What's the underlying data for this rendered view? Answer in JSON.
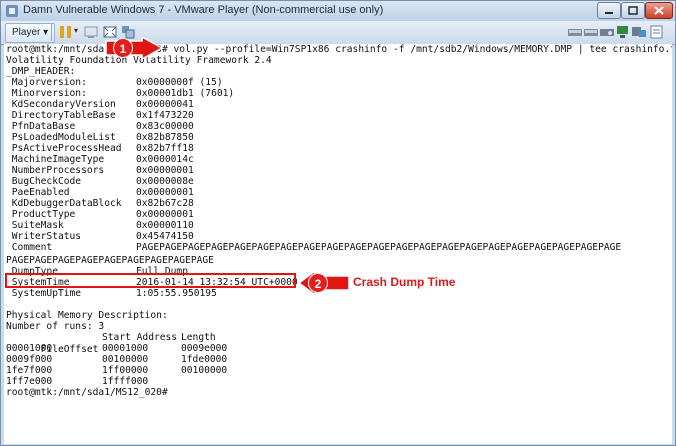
{
  "window": {
    "title": "Damn Vulnerable Windows 7 - VMware Player (Non-commercial use only)",
    "player_menu": "Player"
  },
  "terminal": {
    "prompt_line": "root@mtk:/mnt/sda1/MS12_020# vol.py --profile=Win7SP1x86 crashinfo -f /mnt/sdb2/Windows/MEMORY.DMP | tee crashinfo.txt",
    "banner": "Volatility Foundation Volatility Framework 2.4",
    "header_label": "_DMP_HEADER:",
    "header_rows": [
      {
        "key": " Majorversion:",
        "value": "0x0000000f (15)"
      },
      {
        "key": " Minorversion:",
        "value": "0x00001db1 (7601)"
      },
      {
        "key": " KdSecondaryVersion",
        "value": "0x00000041"
      },
      {
        "key": " DirectoryTableBase",
        "value": "0x1f473220"
      },
      {
        "key": " PfnDataBase",
        "value": "0x83c00000"
      },
      {
        "key": " PsLoadedModuleList",
        "value": "0x82b87850"
      },
      {
        "key": " PsActiveProcessHead",
        "value": "0x82b7ff18"
      },
      {
        "key": " MachineImageType",
        "value": "0x0000014c"
      },
      {
        "key": " NumberProcessors",
        "value": "0x00000001"
      },
      {
        "key": " BugCheckCode",
        "value": "0x0000008e"
      },
      {
        "key": " PaeEnabled",
        "value": "0x00000001"
      },
      {
        "key": " KdDebuggerDataBlock",
        "value": "0x82b67c28"
      },
      {
        "key": " ProductType",
        "value": "0x00000001"
      },
      {
        "key": " SuiteMask",
        "value": "0x00000110"
      },
      {
        "key": " WriterStatus",
        "value": "0x45474150"
      },
      {
        "key": " Comment",
        "value": "PAGEPAGEPAGEPAGEPAGEPAGEPAGEPAGEPAGEPAGEPAGEPAGEPAGEPAGEPAGEPAGEPAGEPAGEPAGEPAGEPAGE"
      }
    ],
    "comment_wrap": "PAGEPAGEPAGEPAGEPAGEPAGEPAGEPAGEPAGE",
    "dump_rows": [
      {
        "key": " DumpType",
        "value": "Full Dump"
      },
      {
        "key": " SystemTime",
        "value": "2016-01-14 13:32:54 UTC+0000"
      },
      {
        "key": " SystemUpTime",
        "value": "1:05:55.950195"
      }
    ],
    "phys_label": "Physical Memory Description:",
    "runs_label": "Number of runs: 3",
    "mem_headers": [
      "FileOffset",
      "Start Address",
      "Length"
    ],
    "mem_rows": [
      [
        "00001000",
        "00001000",
        "0009e000"
      ],
      [
        "0009f000",
        "00100000",
        "1fde0000"
      ],
      [
        "1fe7f000",
        "1ff00000",
        "00100000"
      ],
      [
        "1ff7e000",
        "1ffff000",
        ""
      ]
    ],
    "final_prompt": "root@mtk:/mnt/sda1/MS12_020#"
  },
  "annotations": {
    "badge_1": "1",
    "badge_2": "2",
    "callout": "Crash Dump Time",
    "color": "#e21515"
  }
}
